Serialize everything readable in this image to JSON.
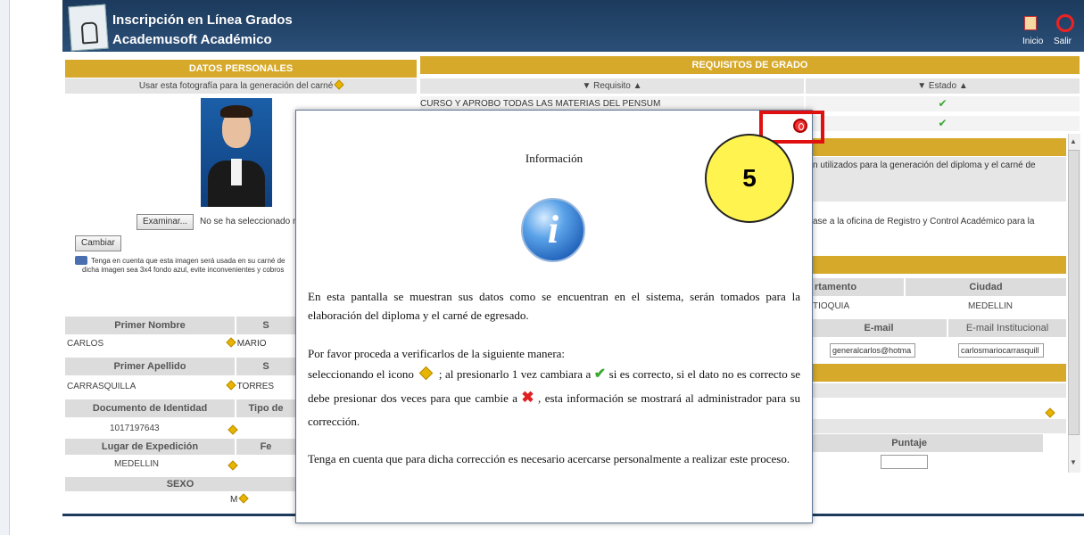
{
  "header": {
    "title": "Inscripción en Línea Grados",
    "subtitle": "Academusoft Académico",
    "inicio": "Inicio",
    "salir": "Salir"
  },
  "personal": {
    "section_title": "DATOS PERSONALES",
    "photo_caption": "Usar esta fotografía para la generación del carné",
    "browse_button": "Examinar...",
    "file_text": "No se ha seleccionado n",
    "change_button": "Cambiar",
    "note_line1": "Tenga en cuenta que esta imagen será usada en su carné de",
    "note_line2": "dicha imagen sea 3x4 fondo azul, evite inconvenientes y cobros",
    "first_name_label": "Primer Nombre",
    "second_name_label_fragment": "S",
    "first_name": "CARLOS",
    "second_name": "MARIO",
    "first_surname_label": "Primer Apellido",
    "second_surname_label_fragment": "S",
    "first_surname": "CARRASQUILLA",
    "second_surname": "TORRES",
    "id_label": "Documento de Identidad",
    "id_type_label": "Tipo de",
    "id_value": "1017197643",
    "place_label": "Lugar de Expedición",
    "date_label_fragment": "Fe",
    "place_value": "MEDELLIN",
    "sex_label": "SEXO",
    "sex_value": "M"
  },
  "requirements": {
    "section_title": "REQUISITOS DE GRADO",
    "col_requisito": "▼ Requisito ▲",
    "col_estado": "▼ Estado ▲",
    "row1": "CURSO Y APROBO TODAS LAS MATERIAS DEL PENSUM"
  },
  "right_panel": {
    "text1a": "n utilizados para la generación del diploma y el carné de",
    "text2": "ase a la oficina de Registro y Control Académico para la",
    "col_departamento": "rtamento",
    "col_ciudad": "Ciudad",
    "departamento": "TIOQUIA",
    "ciudad": "MEDELLIN",
    "col_email": "E-mail",
    "col_email_inst": "E-mail Institucional",
    "email": "generalcarlos@hotma",
    "email_inst": "carlosmariocarrasquill",
    "col_puntaje": "Puntaje"
  },
  "modal": {
    "title": "Información",
    "p1": "En esta pantalla se muestran sus datos como se encuentran en el sistema, serán tomados para la elaboración del diploma y el carné de egresado.",
    "p2": "Por favor proceda a verificarlos de la siguiente manera:",
    "p3a": "seleccionando el icono",
    "p3b": "; al presionarlo 1 vez cambiara a",
    "p3c": "si es correcto, si el dato no es correcto se debe presionar dos veces para que cambie a",
    "p3d": ", esta información se mostrará al administrador para su corrección.",
    "p4": "Tenga en cuenta que para dicha corrección es necesario acercarse personalmente a realizar este proceso."
  },
  "callout": {
    "number": "5"
  },
  "colors": {
    "header": "#1c3a5c",
    "section": "#d6a92a",
    "highlight": "#e01010",
    "callout": "#fff44f"
  }
}
